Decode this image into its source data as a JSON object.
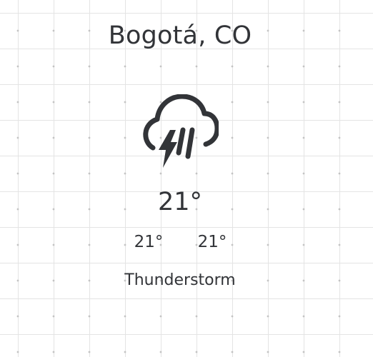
{
  "weather": {
    "location": "Bogotá, CO",
    "temperature": "21°",
    "temp_min": "21°",
    "temp_max": "21°",
    "condition": "Thunderstorm",
    "icon": "thunderstorm-icon",
    "text_color": "#323438"
  }
}
